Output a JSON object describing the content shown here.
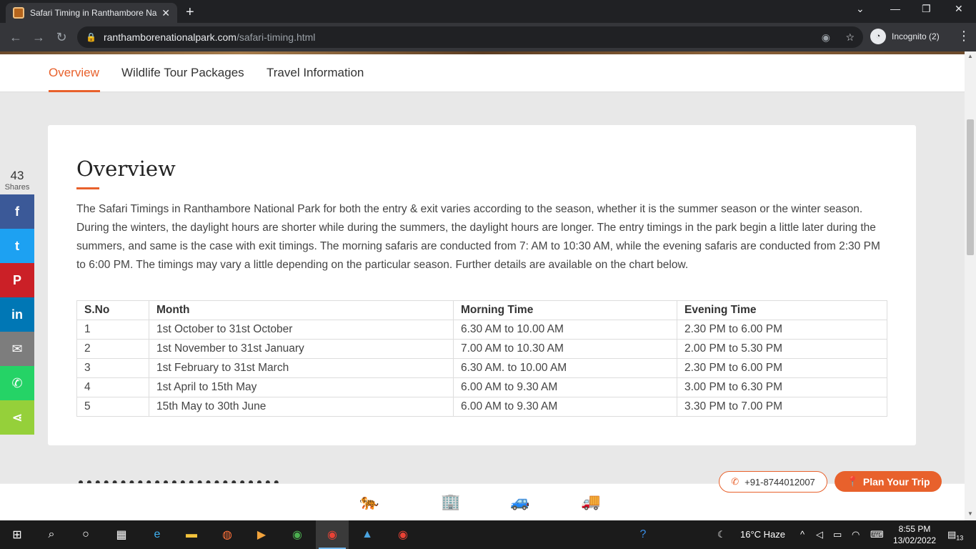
{
  "browser": {
    "tab_title": "Safari Timing in Ranthambore Na",
    "tab_close": "✕",
    "new_tab": "+",
    "url_domain": "ranthamborenationalpark.com",
    "url_path": "/safari-timing.html",
    "incognito_label": "Incognito (2)",
    "menu": "⋮"
  },
  "subnav": {
    "items": [
      "Overview",
      "Wildlife Tour Packages",
      "Travel Information"
    ],
    "active": "Overview"
  },
  "overview": {
    "heading": "Overview",
    "paragraph": "The Safari Timings in Ranthambore National Park for both the entry & exit varies according to the season, whether it is the summer season or the winter season. During the winters, the daylight hours are shorter while during the summers, the daylight hours are longer. The entry timings in the park begin a little later during the summers, and same is the case with exit timings. The morning safaris are conducted from 7: AM to 10:30 AM, while the evening safaris are conducted from 2:30 PM to 6:00 PM. The timings may vary a little depending on the particular season. Further details are available on the chart below."
  },
  "timing_table": {
    "headers": [
      "S.No",
      "Month",
      "Morning Time",
      "Evening Time"
    ],
    "rows": [
      [
        "1",
        "1st October to 31st October",
        "6.30 AM to 10.00 AM",
        "2.30 PM to 6.00 PM"
      ],
      [
        "2",
        "1st November to 31st January",
        "7.00 AM to 10.30 AM",
        "2.00 PM to 5.30 PM"
      ],
      [
        "3",
        "1st February to 31st March",
        "6.30 AM. to 10.00 AM",
        "2.30 PM to 6.00 PM"
      ],
      [
        "4",
        "1st April to 15th May",
        "6.00 AM to 9.30 AM",
        "3.00 PM to 6.30 PM"
      ],
      [
        "5",
        "15th May to 30th June",
        "6.00 AM to 9.30 AM",
        "3.30 PM to 7.00 PM"
      ]
    ]
  },
  "share": {
    "count": "43",
    "label": "Shares",
    "buttons": [
      {
        "name": "facebook",
        "glyph": "f",
        "color": "#3b5998"
      },
      {
        "name": "twitter",
        "glyph": "t",
        "color": "#1da1f2"
      },
      {
        "name": "pinterest",
        "glyph": "P",
        "color": "#cb2027"
      },
      {
        "name": "linkedin",
        "glyph": "in",
        "color": "#0077b5"
      },
      {
        "name": "email",
        "glyph": "✉",
        "color": "#7d7d7d"
      },
      {
        "name": "whatsapp",
        "glyph": "✆",
        "color": "#25d366"
      },
      {
        "name": "share",
        "glyph": "⋖",
        "color": "#95d03a"
      }
    ]
  },
  "cta": {
    "phone": "+91-8744012007",
    "plan": "Plan Your Trip"
  },
  "taskbar": {
    "weather": "16°C  Haze",
    "time": "8:55 PM",
    "date": "13/02/2022",
    "notifications": "13"
  },
  "colors": {
    "accent": "#e8612c",
    "chrome_dark": "#202124"
  }
}
